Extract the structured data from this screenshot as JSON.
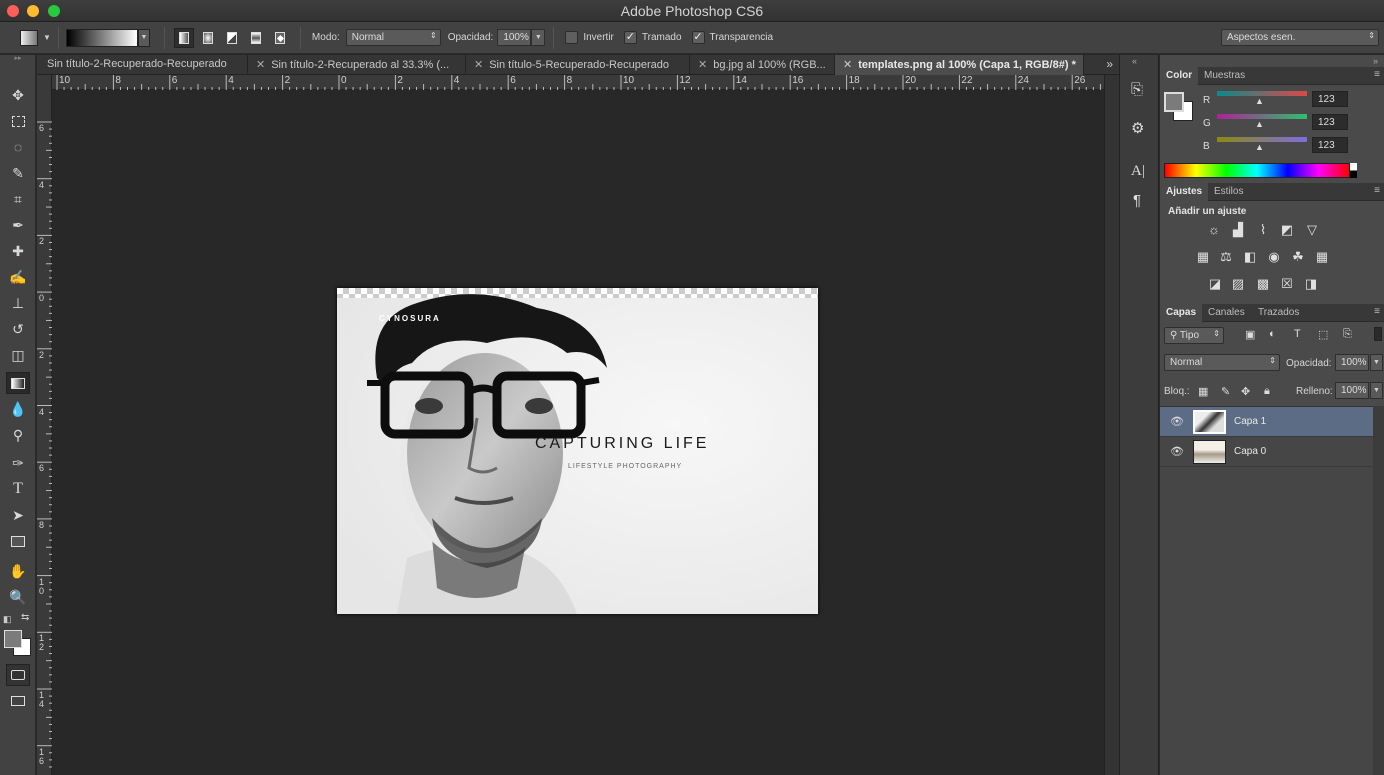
{
  "window": {
    "title": "Adobe Photoshop CS6"
  },
  "options": {
    "mode_label": "Modo:",
    "mode_value": "Normal",
    "opacity_label": "Opacidad:",
    "opacity_value": "100%",
    "invert_label": "Invertir",
    "invert_checked": false,
    "dither_label": "Tramado",
    "dither_checked": true,
    "transparency_label": "Transparencia",
    "transparency_checked": true,
    "workspace": "Aspectos esen."
  },
  "tabs": [
    {
      "label": "Sin título-2-Recuperado-Recuperado",
      "active": false
    },
    {
      "label": "Sin título-2-Recuperado al 33.3% (...",
      "active": false
    },
    {
      "label": "Sin título-5-Recuperado-Recuperado",
      "active": false
    },
    {
      "label": "bg.jpg al 100% (RGB...",
      "active": false
    },
    {
      "label": "templates.png al 100% (Capa 1, RGB/8#) *",
      "active": true
    }
  ],
  "ruler_h": [
    "10",
    "8",
    "6",
    "4",
    "2",
    "0",
    "2",
    "4",
    "6",
    "8",
    "10",
    "12",
    "14",
    "16",
    "18",
    "20",
    "22",
    "24",
    "26"
  ],
  "ruler_v": [
    "6",
    "4",
    "2",
    "0",
    "2",
    "4",
    "6",
    "8",
    "10",
    "12",
    "14",
    "16"
  ],
  "document": {
    "brand": "CYNOSURA",
    "headline": "CAPTURING LIFE",
    "subline": "LIFESTYLE PHOTOGRAPHY"
  },
  "color_panel": {
    "tabs": [
      "Color",
      "Muestras"
    ],
    "channels": [
      {
        "name": "R",
        "value": "123",
        "color": "#e04848"
      },
      {
        "name": "G",
        "value": "123",
        "color": "#29c36b"
      },
      {
        "name": "B",
        "value": "123",
        "color": "#7d6de0"
      }
    ]
  },
  "adjust_panel": {
    "tabs": [
      "Ajustes",
      "Estilos"
    ],
    "heading": "Añadir un ajuste"
  },
  "layers_panel": {
    "tabs": [
      "Capas",
      "Canales",
      "Trazados"
    ],
    "filter": "Tipo",
    "blend": "Normal",
    "opacity_label": "Opacidad:",
    "opacity_value": "100%",
    "lock_label": "Bloq.:",
    "fill_label": "Relleno:",
    "fill_value": "100%",
    "layers": [
      {
        "name": "Capa 1",
        "selected": true
      },
      {
        "name": "Capa 0",
        "selected": false
      }
    ]
  }
}
